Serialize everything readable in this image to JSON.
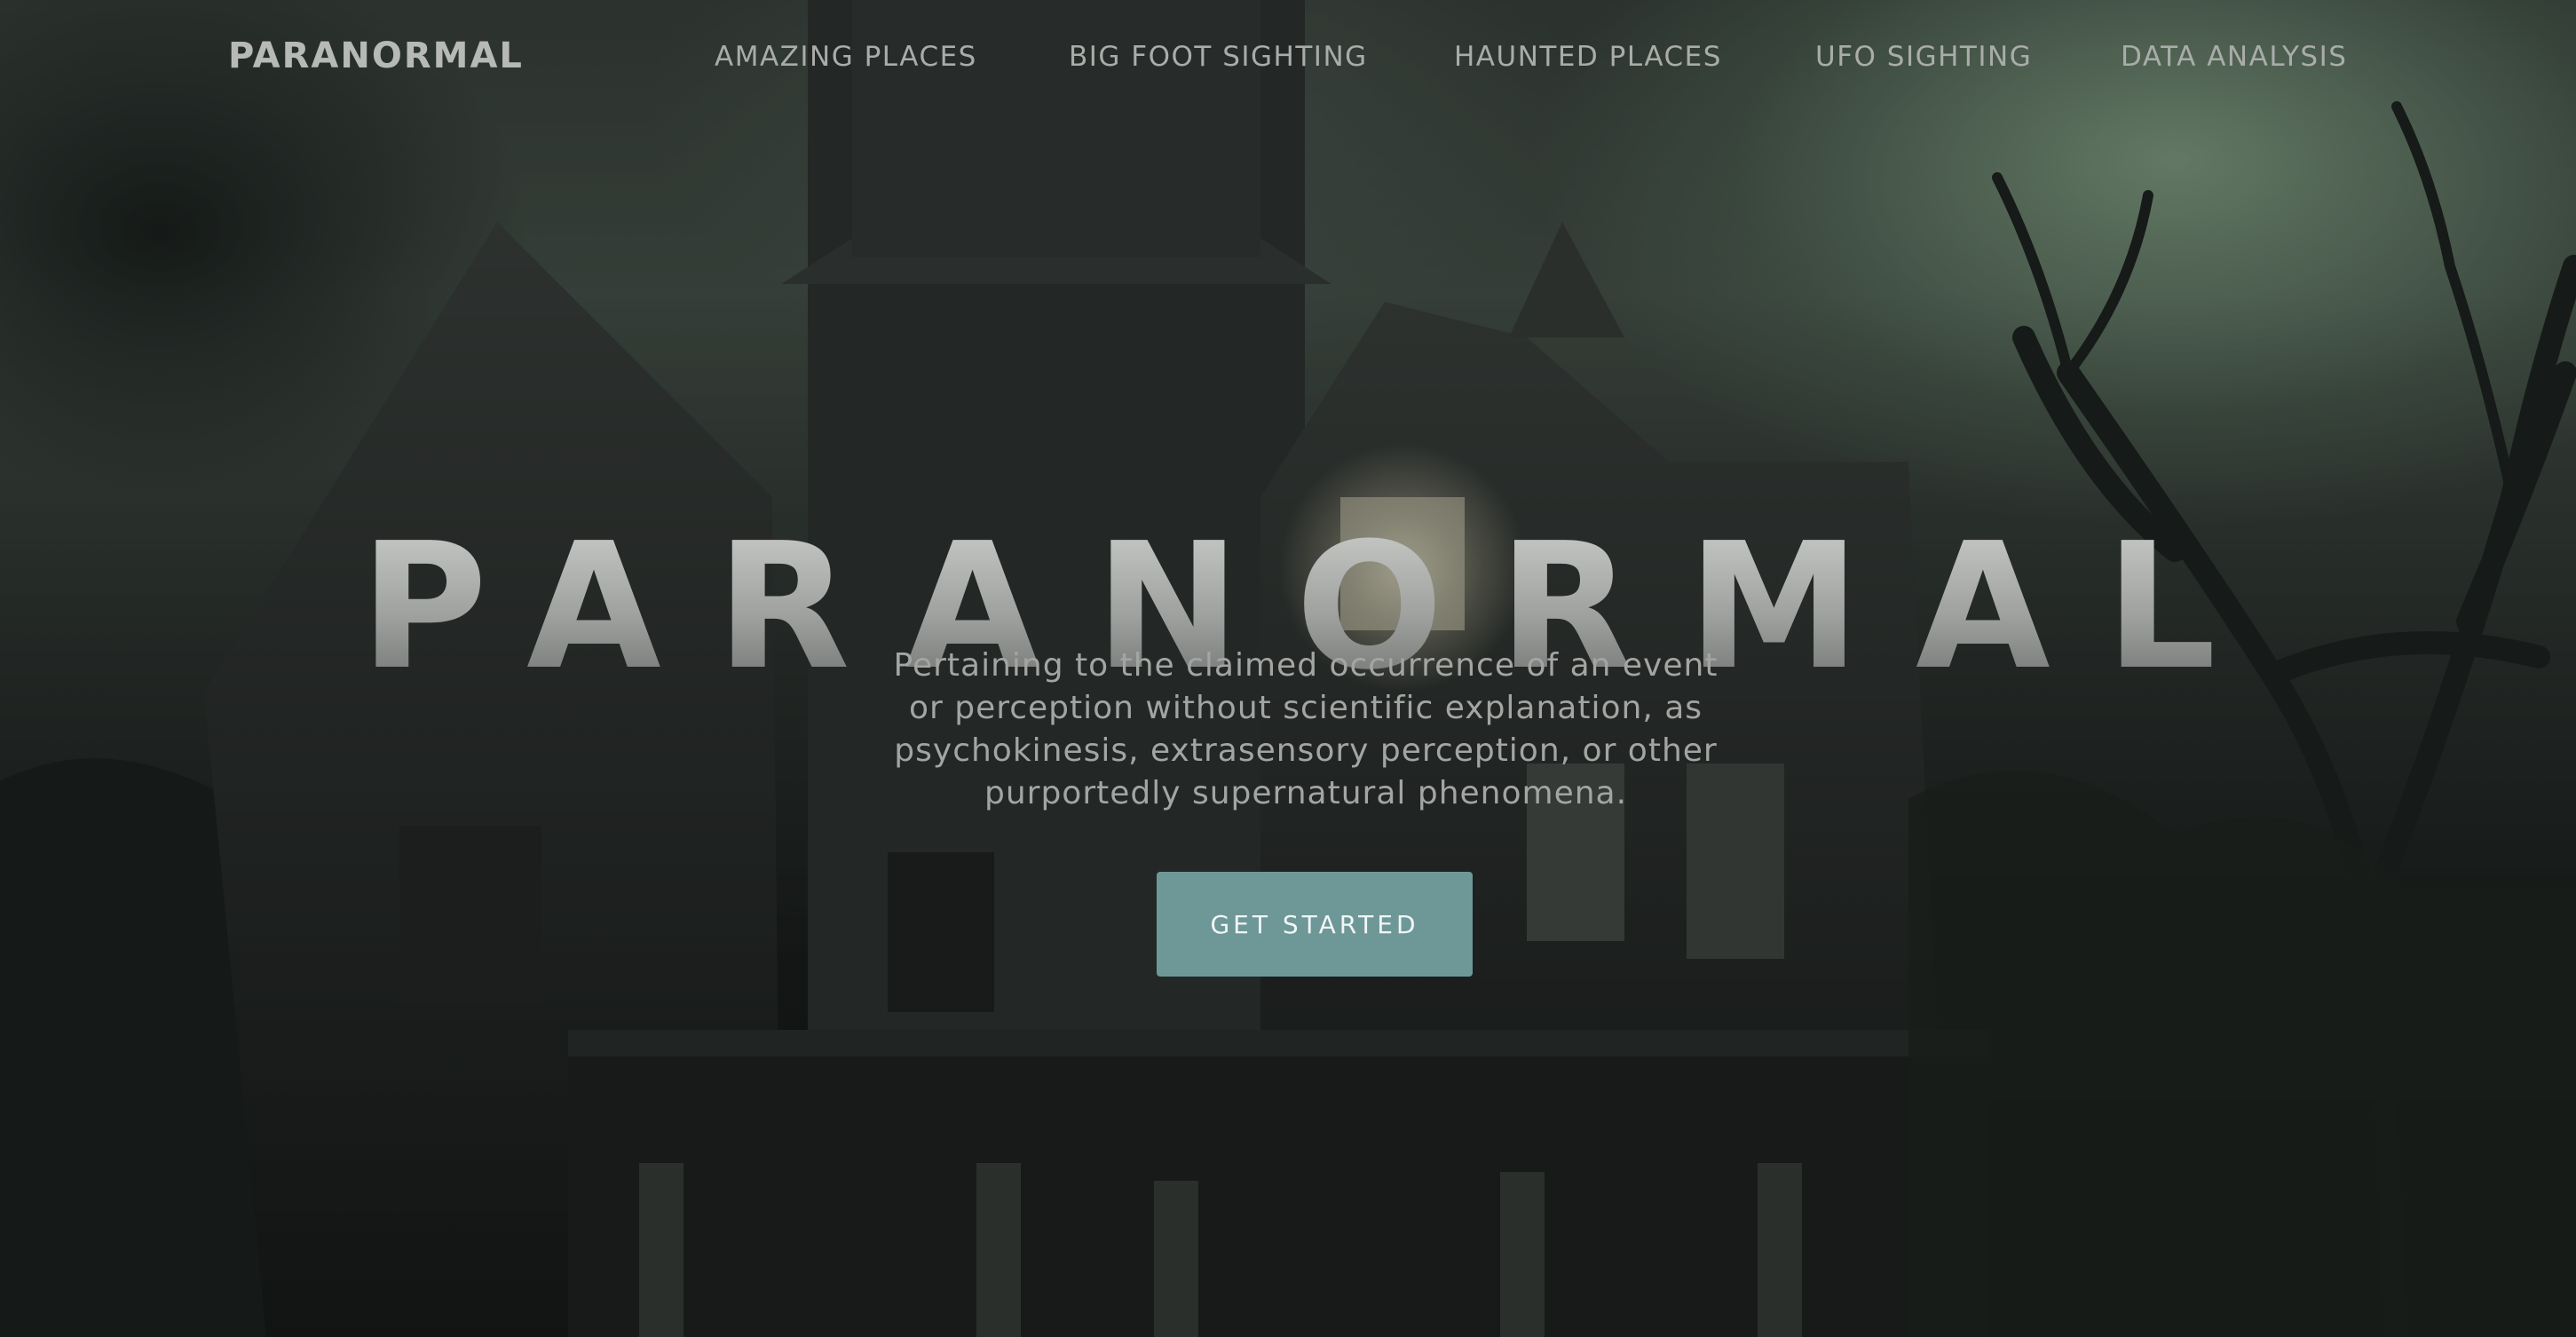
{
  "nav": {
    "brand": "PARANORMAL",
    "links": [
      "AMAZING PLACES",
      "BIG FOOT SIGHTING",
      "HAUNTED PLACES",
      "UFO SIGHTING",
      "DATA ANALYSIS"
    ]
  },
  "hero": {
    "title": "PARANORMAL",
    "description": "Pertaining to the claimed occurrence of an event or perception without scientific explanation, as psychokinesis, extrasensory perception, or other purportedly supernatural phenomena.",
    "cta_label": "GET STARTED",
    "background": "haunted-house-image"
  },
  "colors": {
    "accent": "#6e9898",
    "text": "#a9aca8",
    "brand": "#b6b9b5"
  }
}
